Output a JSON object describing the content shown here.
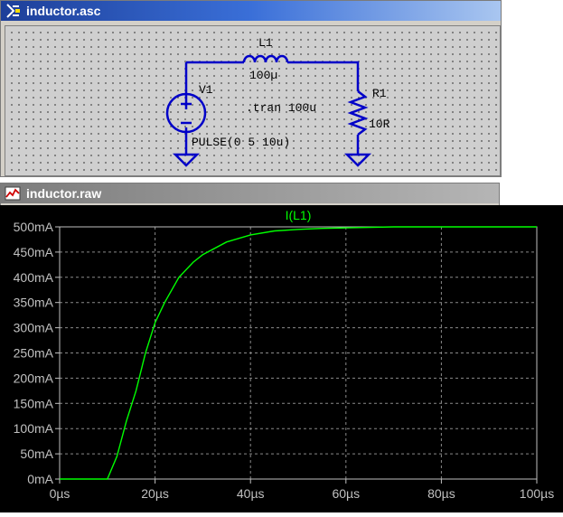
{
  "schematic_window": {
    "title": "inductor.asc",
    "icon": "ltspice-schematic-icon",
    "components": {
      "inductor": {
        "name": "L1",
        "value": "100µ"
      },
      "source": {
        "name": "V1",
        "value": "PULSE(0 5 10u)"
      },
      "resistor": {
        "name": "R1",
        "value": "10R"
      },
      "directive": ".tran 100u"
    }
  },
  "plot_window": {
    "title": "inductor.raw",
    "icon": "waveform-icon",
    "trace_label": "I(L1)",
    "trace_color": "#00ff00"
  },
  "chart_data": {
    "type": "line",
    "title": "I(L1)",
    "xlabel": "",
    "ylabel": "",
    "xlim": [
      0,
      100
    ],
    "ylim": [
      0,
      500
    ],
    "x_ticks": [
      "0µs",
      "20µs",
      "40µs",
      "60µs",
      "80µs",
      "100µs"
    ],
    "y_ticks": [
      "0mA",
      "50mA",
      "100mA",
      "150mA",
      "200mA",
      "250mA",
      "300mA",
      "350mA",
      "400mA",
      "450mA",
      "500mA"
    ],
    "grid": true,
    "series": [
      {
        "name": "I(L1)",
        "color": "#00ff00",
        "x": [
          0,
          10,
          12,
          14,
          16,
          18,
          20,
          22,
          25,
          28,
          30,
          35,
          40,
          45,
          50,
          55,
          60,
          70,
          80,
          100
        ],
        "y": [
          0,
          0,
          45,
          115,
          175,
          250,
          310,
          350,
          400,
          430,
          445,
          470,
          484,
          492,
          495,
          497,
          498,
          500,
          500,
          500
        ]
      }
    ]
  }
}
